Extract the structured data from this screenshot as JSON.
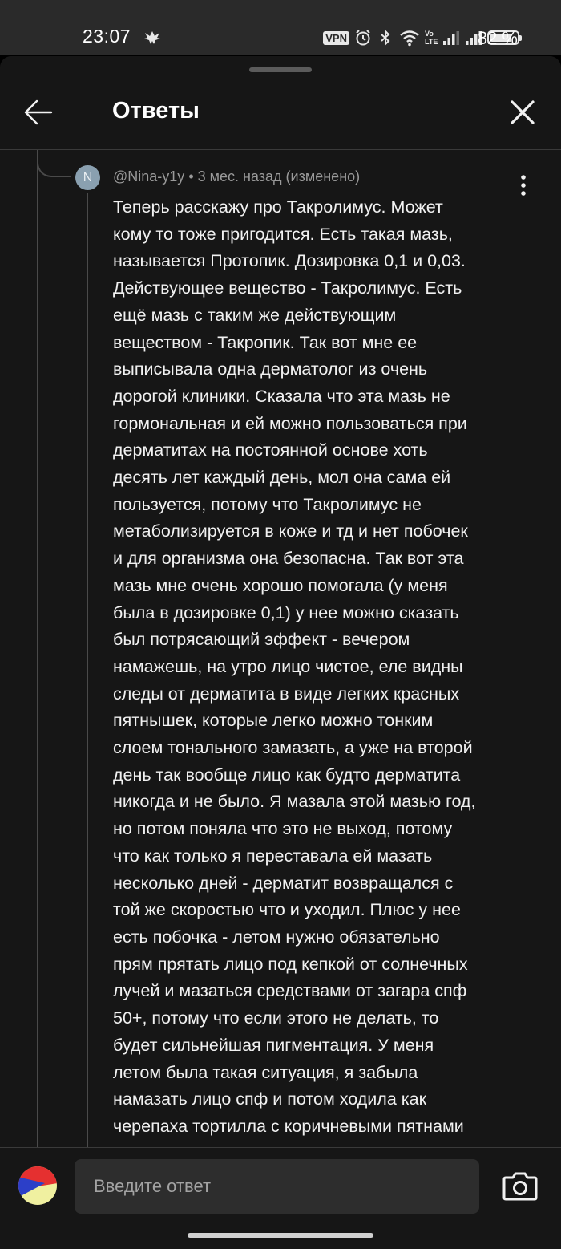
{
  "status_bar": {
    "time": "23:07",
    "vpn_label": "VPN",
    "network_label": "Vo LTE",
    "battery_percent": 82,
    "battery_text": "82 %",
    "icons": [
      "bird-icon",
      "alarm-icon",
      "bluetooth-icon",
      "wifi-icon",
      "signal-icon",
      "signal-icon",
      "battery-icon"
    ]
  },
  "header": {
    "title": "Ответы",
    "back_icon": "arrow-left-icon",
    "close_icon": "close-icon"
  },
  "comment": {
    "avatar_letter": "N",
    "author": "@Nina-y1y",
    "separator": "•",
    "time_ago": "3 мес. назад (изменено)",
    "more_icon": "more-vertical-icon",
    "lines": [
      "Теперь расскажу про Такролимус. Может",
      "кому то тоже пригодится. Есть такая мазь,",
      "называется Протопик. Дозировка 0,1 и 0,03.",
      "Действующее вещество - Такролимус. Есть",
      "ещё мазь с таким же действующим",
      "веществом - Такропик. Так вот мне ее",
      "выписывала одна дерматолог из очень",
      "дорогой клиники. Сказала что эта мазь не",
      "гормональная и ей можно пользоваться при",
      "дерматитах на постоянной основе хоть",
      "десять лет каждый день, мол она сама ей",
      "пользуется, потому что Такролимус не",
      "метаболизируется в коже и тд и нет побочек",
      "и для организма она безопасна.  Так вот эта",
      "мазь мне очень хорошо помогала (у меня",
      "была в дозировке 0,1) у нее можно сказать",
      "был потрясающий эффект - вечером",
      "намажешь, на утро лицо чистое, еле видны",
      "следы от дерматита в виде легких красных",
      "пятнышек, которые легко можно тонким",
      "слоем тонального замазать, а уже на второй",
      "день так вообще лицо как будто дерматита",
      "никогда и не было. Я мазала этой мазью год,",
      "но потом поняла что это не выход, потому",
      "что как только я переставала ей мазать",
      "несколько дней - дерматит возвращался с",
      "той же скоростью что и уходил. Плюс у нее",
      "есть побочка - летом нужно обязательно",
      "прям прятать лицо под кепкой от солнечных",
      "лучей и мазаться средствами от загара спф",
      "50+, потому что если этого не делать, то",
      "будет сильнейшая пигментация. У меня",
      "летом была такая ситуация, я забыла",
      "намазать лицо спф и потом ходила как",
      "черепаха тортилла с коричневыми пятнами"
    ]
  },
  "reply_bar": {
    "placeholder": "Введите ответ",
    "camera_icon": "camera-icon",
    "avatar_icon": "user-avatar-icon"
  },
  "colors": {
    "background": "#161616",
    "status_bar": "#2a2a2a",
    "text": "#f1f1f1",
    "meta_text": "#9a9a9a",
    "input_bg": "#2d2d2d",
    "avatar_bg": "#8aa0b0"
  }
}
